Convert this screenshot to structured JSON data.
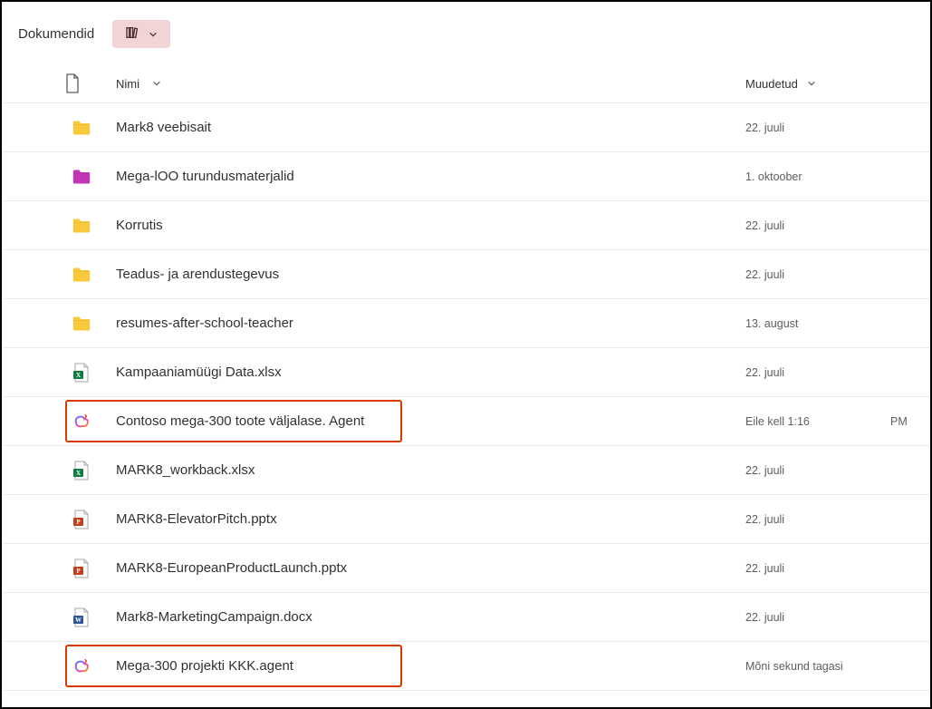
{
  "title": "Dokumendid",
  "columns": {
    "name": "Nimi",
    "modified": "Muudetud"
  },
  "icons": {
    "folder_yellow": "#f8c93a",
    "folder_magenta": "#c335b7",
    "excel": "#107c41",
    "powerpoint": "#c43e1c",
    "word": "#2b579a",
    "copilot": "copilot"
  },
  "rows": [
    {
      "icon": "folder_yellow",
      "name": "Mark8 veebisait",
      "modified": "22. juuli",
      "extra": "",
      "highlight": false,
      "hl_width": 0
    },
    {
      "icon": "folder_magenta",
      "name": "Mega-lOO turundusmaterjalid",
      "modified": "1. oktoober",
      "extra": "",
      "highlight": false,
      "hl_width": 0
    },
    {
      "icon": "folder_yellow",
      "name": "Korrutis",
      "modified": "22. juuli",
      "extra": "",
      "highlight": false,
      "hl_width": 0
    },
    {
      "icon": "folder_yellow",
      "name": "Teadus- ja arendustegevus",
      "modified": "22. juuli",
      "extra": "",
      "highlight": false,
      "hl_width": 0
    },
    {
      "icon": "folder_yellow",
      "name": "resumes-after-school-teacher",
      "modified": "13. august",
      "extra": "",
      "highlight": false,
      "hl_width": 0
    },
    {
      "icon": "excel",
      "name": "Kampaaniamüügi Data.xlsx",
      "modified": "22. juuli",
      "extra": "",
      "highlight": false,
      "hl_width": 0
    },
    {
      "icon": "copilot",
      "name": "Contoso mega-300 toote väljalase. Agent",
      "modified": "Eile kell 1:16",
      "extra": "PM",
      "highlight": true,
      "hl_width": 372
    },
    {
      "icon": "excel",
      "name": "MARK8_workback.xlsx",
      "modified": "22. juuli",
      "extra": "",
      "highlight": false,
      "hl_width": 0
    },
    {
      "icon": "powerpoint",
      "name": "MARK8-ElevatorPitch.pptx",
      "modified": "22. juuli",
      "extra": "",
      "highlight": false,
      "hl_width": 0
    },
    {
      "icon": "powerpoint",
      "name": "MARK8-EuropeanProductLaunch.pptx",
      "modified": "22. juuli",
      "extra": "",
      "highlight": false,
      "hl_width": 0
    },
    {
      "icon": "word",
      "name": "Mark8-MarketingCampaign.docx",
      "modified": "22. juuli",
      "extra": "",
      "highlight": false,
      "hl_width": 0
    },
    {
      "icon": "copilot",
      "name": "Mega-300 projekti KKK.agent",
      "modified": "Mõni sekund tagasi",
      "extra": "",
      "highlight": true,
      "hl_width": 372
    }
  ]
}
